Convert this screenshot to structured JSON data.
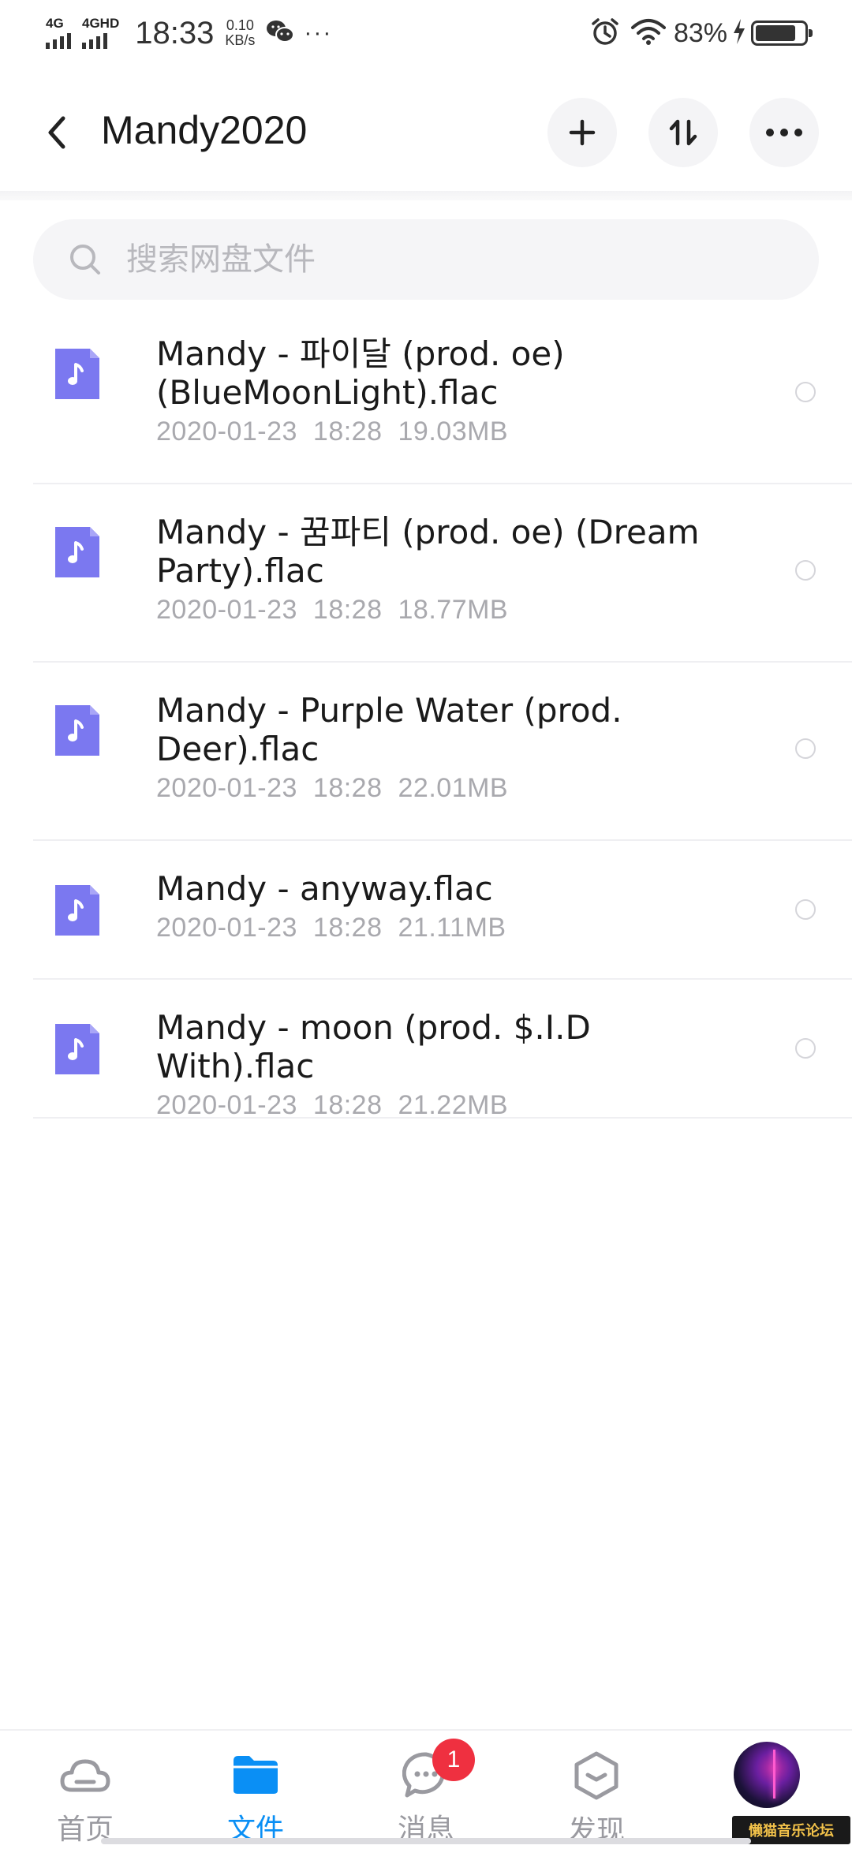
{
  "status_bar": {
    "network_1": "4G",
    "network_2": "4GHD",
    "time": "18:33",
    "speed_value": "0.10",
    "speed_unit": "KB/s",
    "more": "···",
    "battery_percent": "83%",
    "battery_level": 0.83
  },
  "header": {
    "title": "Mandy2020"
  },
  "search": {
    "placeholder": "搜索网盘文件"
  },
  "files": [
    {
      "name": "Mandy - 파이달 (prod. oe) (BlueMoonLight).flac",
      "date": "2020-01-23",
      "time": "18:28",
      "size": "19.03MB"
    },
    {
      "name": "Mandy - 꿈파티 (prod. oe) (Dream Party).flac",
      "date": "2020-01-23",
      "time": "18:28",
      "size": "18.77MB"
    },
    {
      "name": "Mandy - Purple Water (prod. Deer).flac",
      "date": "2020-01-23",
      "time": "18:28",
      "size": "22.01MB"
    },
    {
      "name": "Mandy - anyway.flac",
      "date": "2020-01-23",
      "time": "18:28",
      "size": "21.11MB"
    },
    {
      "name": "Mandy - moon (prod. $.I.D With).flac",
      "date": "2020-01-23",
      "time": "18:28",
      "size": "21.22MB"
    }
  ],
  "bottom_nav": {
    "items": [
      {
        "label": "首页",
        "icon": "cloud-icon"
      },
      {
        "label": "文件",
        "icon": "folder-icon"
      },
      {
        "label": "消息",
        "icon": "message-icon"
      },
      {
        "label": "发现",
        "icon": "discover-icon"
      }
    ],
    "active_index": 1,
    "message_badge": "1"
  },
  "watermark": "懒猫音乐论坛",
  "colors": {
    "accent": "#0a8ff5",
    "file_icon": "#7b78f0",
    "badge": "#ef3040"
  }
}
